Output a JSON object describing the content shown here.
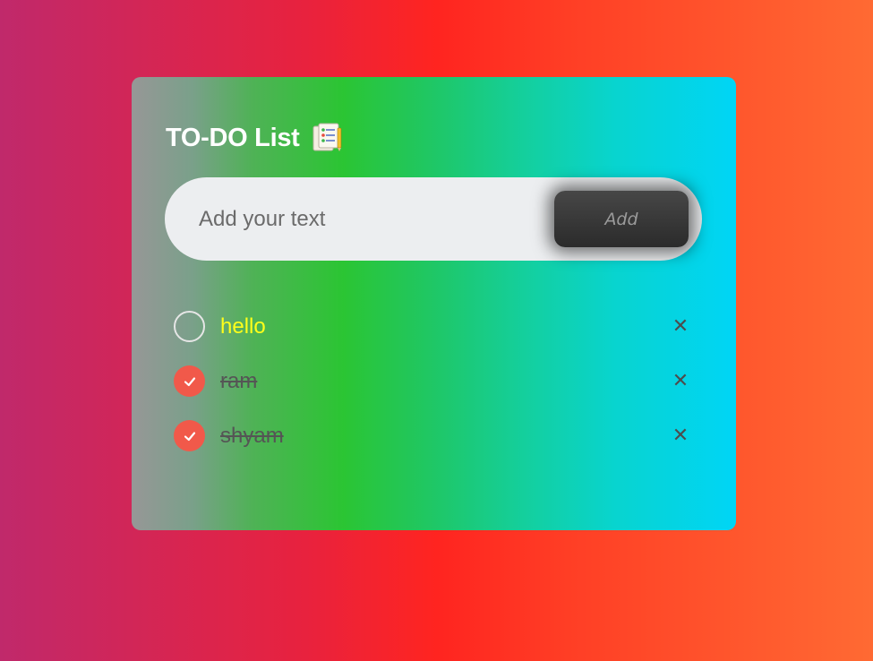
{
  "app": {
    "title": "TO-DO List",
    "title_icon": "clipboard-notes-icon"
  },
  "input": {
    "placeholder": "Add your text",
    "value": "",
    "add_label": "Add"
  },
  "todos": [
    {
      "text": "hello",
      "done": false
    },
    {
      "text": "ram",
      "done": true
    },
    {
      "text": "shyam",
      "done": true
    }
  ],
  "remove_glyph": "✕",
  "colors": {
    "accent_check": "#f1594a",
    "active_text": "#ffff1a",
    "done_text": "#555555"
  }
}
